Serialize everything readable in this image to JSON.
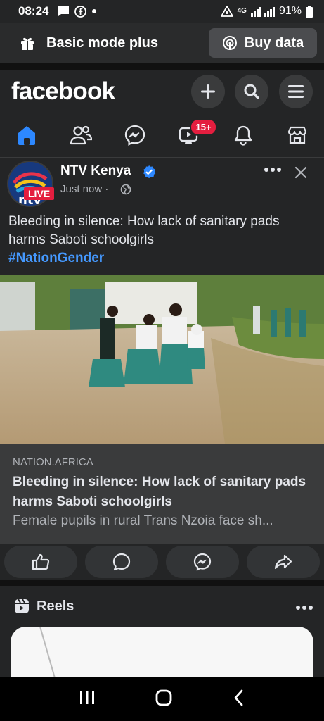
{
  "status_bar": {
    "time": "08:24",
    "network": "4G",
    "battery": "91%"
  },
  "mode_banner": {
    "label": "Basic mode plus",
    "buy_data_label": "Buy data"
  },
  "header": {
    "brand": "facebook"
  },
  "nav": {
    "tabs": [
      "home",
      "friends",
      "messenger",
      "video",
      "notifications",
      "marketplace"
    ],
    "video_badge": "15+",
    "active": "home"
  },
  "post": {
    "author": "NTV Kenya",
    "live_label": "LIVE",
    "timestamp": "Just now",
    "text": "Bleeding in silence: How lack of sanitary pads harms Saboti schoolgirls",
    "hashtag": "#NationGender",
    "link": {
      "domain": "NATION.AFRICA",
      "title": "Bleeding in silence: How lack of sanitary pads harms Saboti schoolgirls",
      "description": "Female pupils in rural Trans Nzoia face sh..."
    }
  },
  "reels": {
    "title": "Reels"
  },
  "colors": {
    "accent": "#2d88ff",
    "badge": "#e41e3f",
    "link": "#4599ff",
    "background": "#242526"
  }
}
